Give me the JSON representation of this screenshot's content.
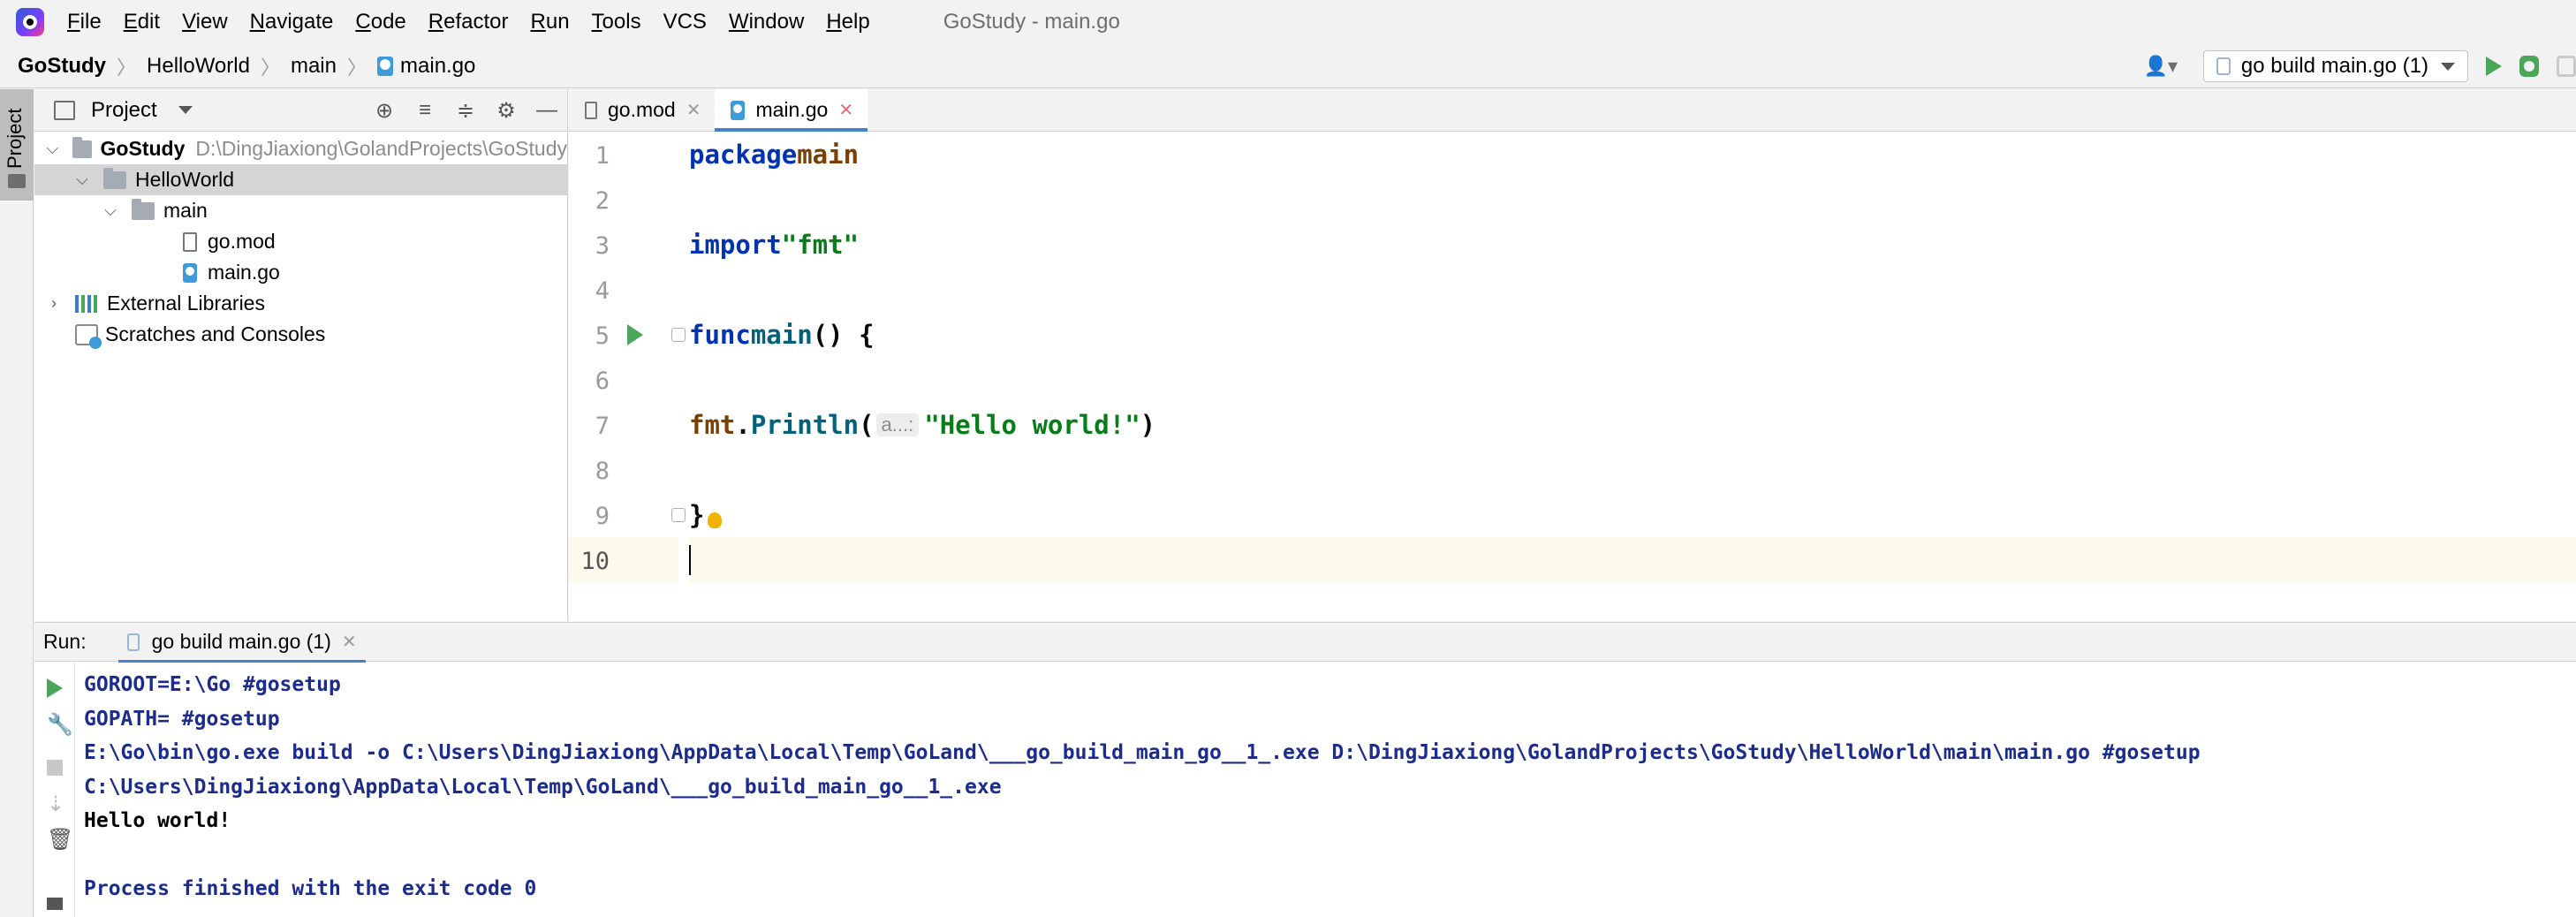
{
  "menubar": {
    "items": [
      {
        "u": "F",
        "rest": "ile"
      },
      {
        "u": "E",
        "rest": "dit"
      },
      {
        "u": "V",
        "rest": "iew"
      },
      {
        "u": "N",
        "rest": "avigate"
      },
      {
        "u": "C",
        "rest": "ode"
      },
      {
        "u": "R",
        "rest": "efactor"
      },
      {
        "u": "R",
        "rest": "un"
      },
      {
        "u": "T",
        "rest": "ools"
      },
      {
        "u": "",
        "rest": "VCS"
      },
      {
        "u": "W",
        "rest": "indow"
      },
      {
        "u": "H",
        "rest": "elp"
      }
    ],
    "window_title": "GoStudy - main.go"
  },
  "breadcrumbs": [
    "GoStudy",
    "HelloWorld",
    "main",
    "main.go"
  ],
  "toolbar": {
    "run_config": "go build main.go (1)",
    "run_color": "#4ca65a"
  },
  "left_strip": {
    "project_tab": "Project"
  },
  "project_panel": {
    "title": "Project",
    "root": {
      "name": "GoStudy",
      "path": "D:\\DingJiaxiong\\GolandProjects\\GoStudy"
    },
    "hello_world": "HelloWorld",
    "main_folder": "main",
    "files": [
      "go.mod",
      "main.go"
    ],
    "external_libraries": "External Libraries",
    "scratches": "Scratches and Consoles"
  },
  "editor": {
    "tabs": [
      {
        "label": "go.mod",
        "active": false
      },
      {
        "label": "main.go",
        "active": true
      }
    ],
    "line_numbers": [
      "1",
      "2",
      "3",
      "4",
      "5",
      "6",
      "7",
      "8",
      "9",
      "10"
    ],
    "code": {
      "l1_kw": "package",
      "l1_name": "main",
      "l3_kw": "import",
      "l3_str": "\"fmt\"",
      "l5_kw": "func",
      "l5_name": "main",
      "l5_rest": "() {",
      "l7_pkg": "fmt",
      "l7_dot": ".",
      "l7_fn": "Println",
      "l7_open": "(",
      "l7_hint": "a...:",
      "l7_str": "\"Hello world!\"",
      "l7_close": ")",
      "l9": "}"
    }
  },
  "run_panel": {
    "label": "Run:",
    "tab": "go build main.go (1)",
    "console": [
      "GOROOT=E:\\Go #gosetup",
      "GOPATH= #gosetup",
      "E:\\Go\\bin\\go.exe build -o C:\\Users\\DingJiaxiong\\AppData\\Local\\Temp\\GoLand\\___go_build_main_go__1_.exe D:\\DingJiaxiong\\GolandProjects\\GoStudy\\HelloWorld\\main\\main.go #gosetup",
      "C:\\Users\\DingJiaxiong\\AppData\\Local\\Temp\\GoLand\\___go_build_main_go__1_.exe",
      "Hello world!",
      "",
      "Process finished with the exit code 0"
    ]
  }
}
